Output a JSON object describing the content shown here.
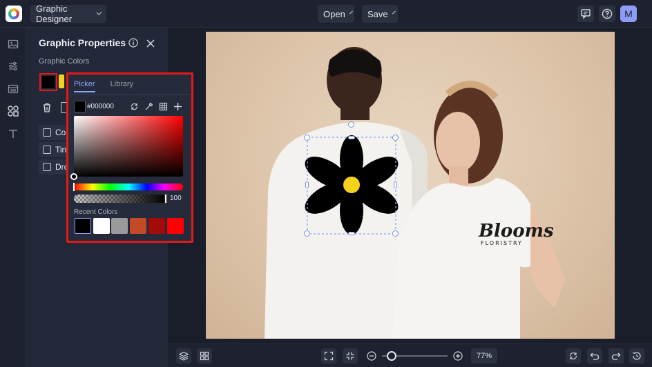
{
  "app": {
    "mode_label": "Graphic Designer",
    "open_label": "Open",
    "save_label": "Save",
    "avatar_initial": "M"
  },
  "panel": {
    "title": "Graphic Properties",
    "colors_label": "Graphic Colors",
    "graphic_colors": [
      "#000000",
      "#f4d21c"
    ],
    "options": [
      {
        "label": "Col"
      },
      {
        "label": "Tin"
      },
      {
        "label": "Dro"
      }
    ]
  },
  "color_picker": {
    "tabs": [
      "Picker",
      "Library"
    ],
    "active_tab": "Picker",
    "hex_value": "#000000",
    "alpha_value": "100",
    "recent_label": "Recent Colors",
    "recent_colors": [
      "#000000",
      "#ffffff",
      "#9a9a9a",
      "#c24a27",
      "#a30a0a",
      "#ff0000"
    ]
  },
  "canvas": {
    "shirt_text_line1": "Blooms",
    "shirt_text_line2": "FLORISTRY",
    "flower_petal_color": "#000000",
    "flower_center_color": "#f4d21c"
  },
  "zoom": {
    "level": "77%",
    "slider_fraction": 0.15
  },
  "icons": {
    "rail": [
      "image-icon",
      "sliders-icon",
      "layout-icon",
      "shapes-icon",
      "text-icon"
    ],
    "top_right": [
      "comment-icon",
      "help-icon"
    ],
    "bottom": [
      "layers-icon",
      "grid-icon",
      "fit-screen-icon",
      "shrink-icon",
      "zoom-out-icon",
      "zoom-in-icon",
      "sync-icon",
      "undo-icon",
      "redo-icon",
      "history-icon"
    ]
  },
  "colors": {
    "accent": "#8ea2ff",
    "highlight_border": "#e21a1a",
    "avatar": "#8f9cf7"
  }
}
